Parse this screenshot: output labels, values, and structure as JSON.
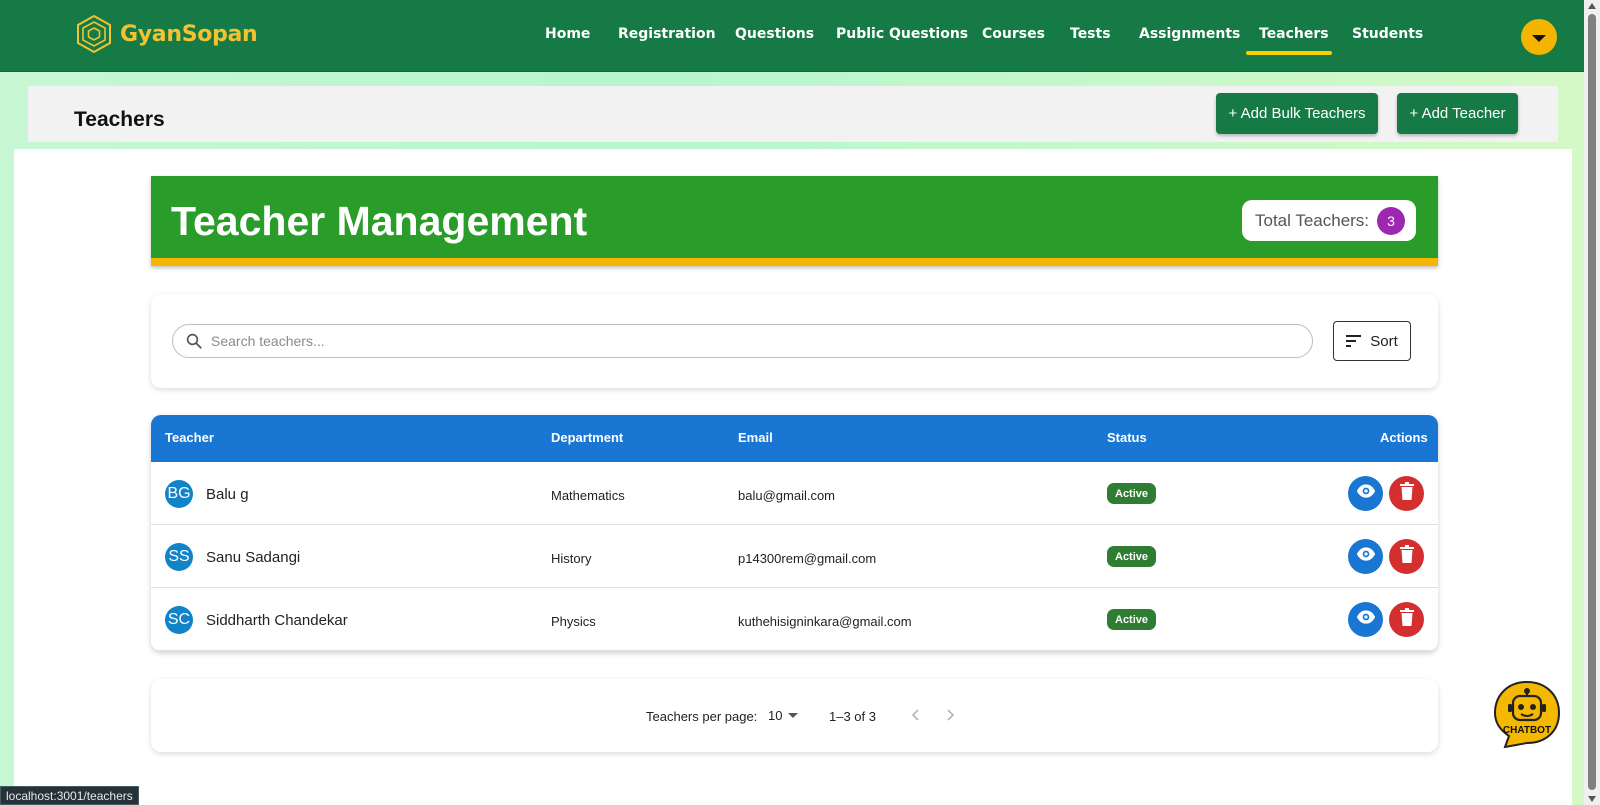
{
  "app": {
    "logo_text": "GyanSopan"
  },
  "nav": {
    "items": [
      "Home",
      "Registration",
      "Questions",
      "Public Questions",
      "Courses",
      "Tests",
      "Assignments",
      "Teachers",
      "Students"
    ],
    "active": "Teachers"
  },
  "header": {
    "title": "Teachers",
    "add_bulk_label": "+ Add Bulk Teachers",
    "add_label": "+ Add Teacher"
  },
  "banner": {
    "title": "Teacher Management",
    "total_label": "Total Teachers:",
    "total_count": "3"
  },
  "search": {
    "placeholder": "Search teachers...",
    "sort_label": "Sort"
  },
  "table": {
    "columns": [
      "Teacher",
      "Department",
      "Email",
      "Status",
      "Actions"
    ],
    "rows": [
      {
        "initials": "BG",
        "name": "Balu g",
        "department": "Mathematics",
        "email": "balu@gmail.com",
        "status": "Active"
      },
      {
        "initials": "SS",
        "name": "Sanu Sadangi",
        "department": "History",
        "email": "p14300rem@gmail.com",
        "status": "Active"
      },
      {
        "initials": "SC",
        "name": "Siddharth Chandekar",
        "department": "Physics",
        "email": "kuthehisigninkara@gmail.com",
        "status": "Active"
      }
    ]
  },
  "pagination": {
    "per_page_label": "Teachers per page:",
    "per_page": "10",
    "range": "1–3 of 3"
  },
  "chatbot": {
    "label": "CHATBOT"
  },
  "statusbar": {
    "url": "localhost:3001/teachers"
  },
  "colors": {
    "nav_bg": "#157a45",
    "logo": "#f2c230",
    "active_underline": "#f6d000",
    "banner_bg": "#2a9c2a",
    "banner_border": "#f6b600",
    "table_header": "#1976d2",
    "status_active": "#2e7d32",
    "delete": "#d32f2f",
    "count_badge": "#9c27b0"
  },
  "icons": [
    "logo-hexagon-icon",
    "chevron-down-icon",
    "search-icon",
    "sort-icon",
    "eye-icon",
    "trash-icon",
    "chevron-left-icon",
    "chevron-right-icon",
    "chatbot-robot-icon"
  ]
}
